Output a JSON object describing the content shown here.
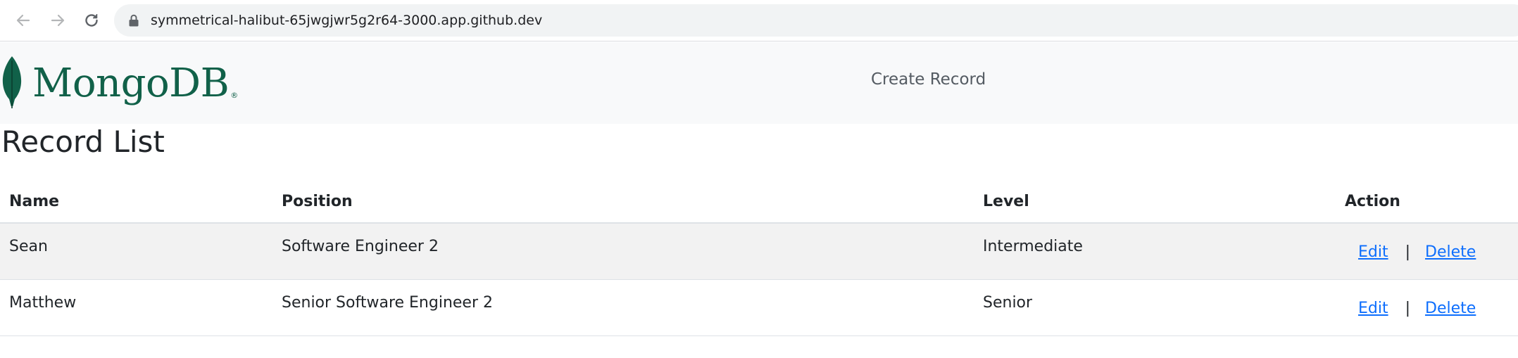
{
  "browser": {
    "url": "symmetrical-halibut-65jwgjwr5g2r64-3000.app.github.dev"
  },
  "navbar": {
    "brand_name": "MongoDB",
    "brand_reg": "®",
    "create_link": "Create Record",
    "brand_color": "#116149"
  },
  "page": {
    "title": "Record List"
  },
  "table": {
    "headers": [
      "Name",
      "Position",
      "Level",
      "Action"
    ],
    "rows": [
      {
        "name": "Sean",
        "position": "Software Engineer 2",
        "level": "Intermediate",
        "edit": "Edit",
        "separator": "|",
        "delete": "Delete"
      },
      {
        "name": "Matthew",
        "position": "Senior Software Engineer 2",
        "level": "Senior",
        "edit": "Edit",
        "separator": "|",
        "delete": "Delete"
      }
    ]
  },
  "icons": [
    "back-arrow-icon",
    "forward-arrow-icon",
    "reload-icon",
    "lock-icon",
    "mongodb-leaf-icon"
  ],
  "colors": {
    "link": "#0d6efd",
    "navbar_bg": "#f8f9fa",
    "stripe": "#f2f2f2"
  }
}
